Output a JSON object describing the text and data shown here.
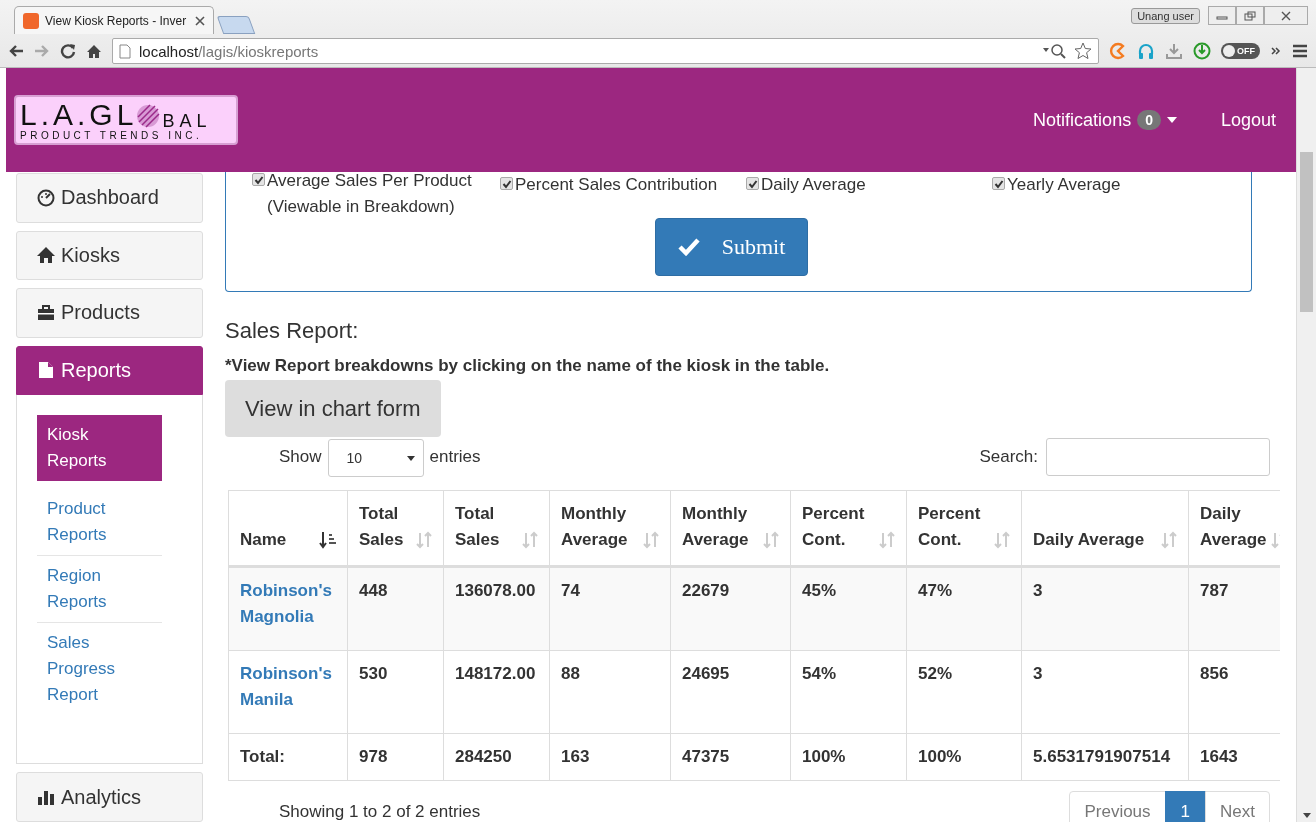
{
  "browser": {
    "tab_title": "View Kiosk Reports - Inver",
    "url_host": "localhost",
    "url_path": "/lagis/kioskreports",
    "user_badge": "Unang user",
    "toggle": {
      "label": "OFF",
      "on": false
    }
  },
  "header": {
    "logo": {
      "main": "L.A.GL",
      "main_end": "BAL",
      "sub": "PRODUCT TRENDS INC."
    },
    "notifications": {
      "label": "Notifications",
      "count": "0"
    },
    "logout": "Logout"
  },
  "sidebar": {
    "items": [
      {
        "label": "Dashboard",
        "selected": false
      },
      {
        "label": "Kiosks",
        "selected": false
      },
      {
        "label": "Products",
        "selected": false
      },
      {
        "label": "Reports",
        "selected": true,
        "children": [
          {
            "label": "Kiosk Reports",
            "selected": true
          },
          {
            "label": "Product Reports",
            "selected": false
          },
          {
            "label": "Region Reports",
            "selected": false
          },
          {
            "label": "Sales Progress Report",
            "selected": false
          }
        ]
      },
      {
        "label": "Analytics",
        "selected": false
      }
    ]
  },
  "options": {
    "checkboxes": [
      {
        "label": "Average Sales Per Product (Viewable in Breakdown)",
        "checked": true
      },
      {
        "label": "Percent Sales Contribution",
        "checked": true
      },
      {
        "label": "Daily Average",
        "checked": true
      },
      {
        "label": "Yearly Average",
        "checked": true
      }
    ],
    "submit": "Submit"
  },
  "report": {
    "title": "Sales Report:",
    "note": "*View Report breakdowns by clicking on the name of the kiosk in the table.",
    "chart_button": "View in chart form",
    "show_label": "Show",
    "page_size": "10",
    "entries_label": "entries",
    "search_label": "Search:"
  },
  "table": {
    "columns": [
      {
        "label": "Name",
        "sorted": true
      },
      {
        "label": "Total Sales",
        "sorted": false
      },
      {
        "label": "Total Sales",
        "sorted": false
      },
      {
        "label": "Monthly Average",
        "sorted": false
      },
      {
        "label": "Monthly Average",
        "sorted": false
      },
      {
        "label": "Percent Cont.",
        "sorted": false
      },
      {
        "label": "Percent Cont.",
        "sorted": false
      },
      {
        "label": "Daily Average",
        "sorted": false
      },
      {
        "label": "Daily Average",
        "sorted": false
      }
    ],
    "rows": [
      {
        "kind": "data",
        "cells": [
          "Robinson's Magnolia",
          "448",
          "136078.00",
          "74",
          "22679",
          "45%",
          "47%",
          "3",
          "787"
        ]
      },
      {
        "kind": "data",
        "cells": [
          "Robinson's Manila",
          "530",
          "148172.00",
          "88",
          "24695",
          "54%",
          "52%",
          "3",
          "856"
        ]
      },
      {
        "kind": "total",
        "cells": [
          "Total:",
          "978",
          "284250",
          "163",
          "47375",
          "100%",
          "100%",
          "5.6531791907514",
          "1643"
        ]
      }
    ]
  },
  "footer": {
    "info": "Showing 1 to 2 of 2 entries",
    "pagination": [
      {
        "label": "Previous",
        "selected": false
      },
      {
        "label": "1",
        "selected": true
      },
      {
        "label": "Next",
        "selected": false
      }
    ]
  }
}
